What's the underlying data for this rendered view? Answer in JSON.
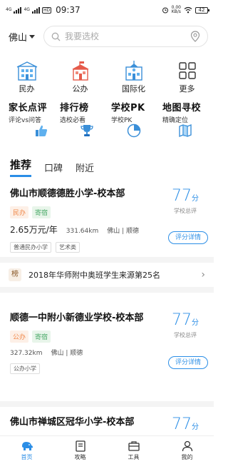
{
  "status_bar": {
    "net1": "4G",
    "net2": "4G",
    "hd": "HD",
    "time": "09:37",
    "speed": "0.00",
    "speed_unit": "KB/s",
    "battery": "42"
  },
  "search": {
    "city": "佛山",
    "placeholder": "我要选校"
  },
  "categories": [
    {
      "label": "民办",
      "icon": "private-school-icon"
    },
    {
      "label": "公办",
      "icon": "public-school-icon"
    },
    {
      "label": "国际化",
      "icon": "international-school-icon"
    },
    {
      "label": "更多",
      "icon": "more-grid-icon"
    }
  ],
  "features": [
    {
      "title": "家长点评",
      "subtitle": "评论vs问答",
      "icon": "thumbs-up-icon"
    },
    {
      "title": "排行榜",
      "subtitle": "选校必看",
      "icon": "trophy-icon"
    },
    {
      "title": "学校PK",
      "subtitle": "学校PK",
      "icon": "pie-chart-icon"
    },
    {
      "title": "地图寻校",
      "subtitle": "精确定位",
      "icon": "map-icon"
    }
  ],
  "tabs": [
    "推荐",
    "口碑",
    "附近"
  ],
  "cards": [
    {
      "name": "佛山市顺德德胜小学-校本部",
      "tags": [
        "民办",
        "寄宿"
      ],
      "price": "2.65万元/年",
      "distance": "331.64km",
      "location": "佛山 | 顺德",
      "chips": [
        "普通民办小学",
        "艺术类"
      ],
      "score": "77",
      "score_unit": "分",
      "score_label": "学校总评",
      "detail": "评分详情"
    },
    {
      "name": "顺德一中附小新德业学校-校本部",
      "tags": [
        "公办",
        "寄宿"
      ],
      "distance": "327.32km",
      "location": "佛山 | 顺德",
      "chips": [
        "公办小学"
      ],
      "score": "77",
      "score_unit": "分",
      "score_label": "学校总评",
      "detail": "评分详情"
    },
    {
      "name": "佛山市禅城区冠华小学-校本部",
      "score": "77",
      "score_unit": "分"
    }
  ],
  "ranking": {
    "badge": "榜",
    "text": "2018年华师附中奥班学生来源第25名"
  },
  "nav": [
    {
      "label": "首页",
      "icon": "home-elephant-icon",
      "active": true
    },
    {
      "label": "攻略",
      "icon": "book-icon",
      "active": false
    },
    {
      "label": "工具",
      "icon": "briefcase-icon",
      "active": false
    },
    {
      "label": "我的",
      "icon": "user-icon",
      "active": false
    }
  ],
  "colors": {
    "accent": "#2b8ee6",
    "tag_orange": "#f0884a",
    "tag_green": "#4caa6a",
    "icon_blue": "#3a8fd8"
  }
}
